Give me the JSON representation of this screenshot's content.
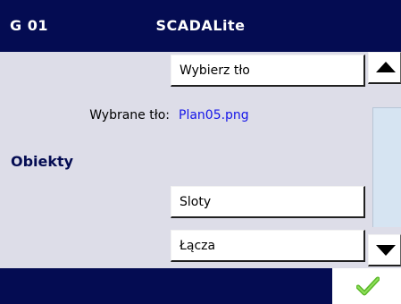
{
  "header": {
    "id": "G 01",
    "app_title": "SCADALite"
  },
  "main": {
    "choose_background_button": "Wybierz tło",
    "selected_background_label": "Wybrane tło:",
    "selected_background_value": "Plan05.png",
    "section_title": "Obiekty",
    "slots_button": "Sloty",
    "links_button": "Łącza"
  },
  "scrollbar": {
    "up_icon": "triangle-up-icon",
    "down_icon": "triangle-down-icon"
  },
  "footer": {
    "confirm_icon": "checkmark-icon"
  },
  "colors": {
    "header_bg": "#040c52",
    "value_text": "#1515e8",
    "confirm_green": "#5cb82a"
  }
}
